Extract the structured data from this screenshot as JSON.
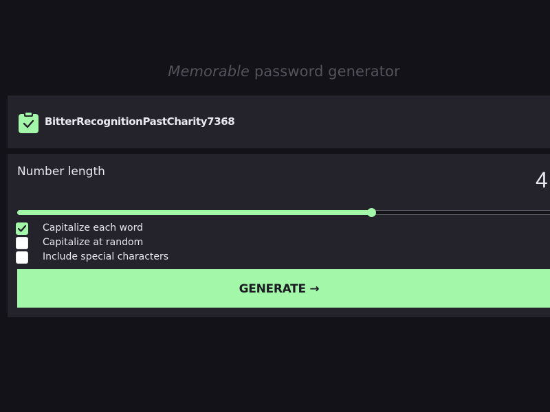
{
  "heading": {
    "emphasis": "Memorable",
    "rest": " password generator"
  },
  "result": {
    "password": "BitterRecognitionPastCharity7368",
    "icon": "clipboard-check-icon"
  },
  "settings": {
    "number_length_label": "Number length",
    "number_length_value": "4",
    "slider_fraction": 0.655,
    "options": [
      {
        "label": "Capitalize each word",
        "checked": true
      },
      {
        "label": "Capitalize at random",
        "checked": false
      },
      {
        "label": "Include special characters",
        "checked": false
      }
    ],
    "generate_label": "GENERATE →"
  },
  "colors": {
    "accent": "#a3f7a9",
    "background": "#131218",
    "panel": "#24232b",
    "heading": "#54535c"
  }
}
